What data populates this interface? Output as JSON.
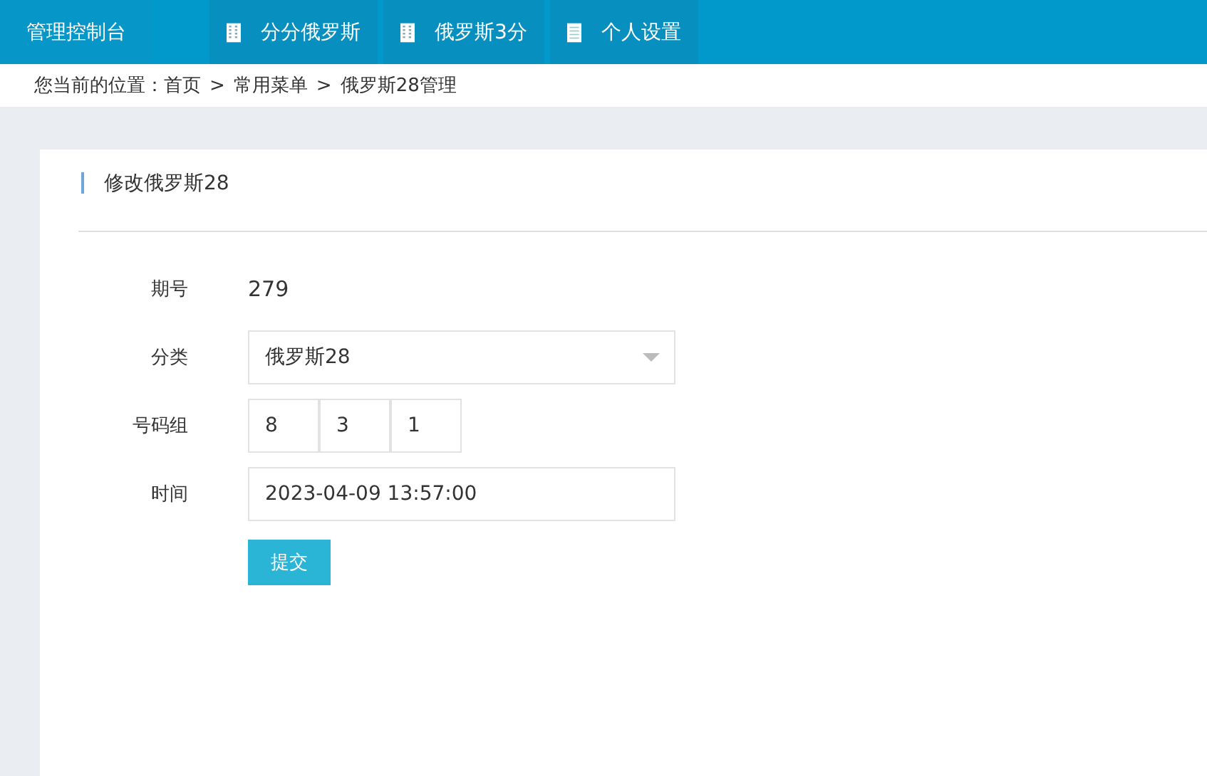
{
  "top_nav": {
    "brand": "管理控制台",
    "items": [
      {
        "label": "分分俄罗斯"
      },
      {
        "label": "俄罗斯3分"
      },
      {
        "label": "个人设置",
        "kind": "doc"
      }
    ]
  },
  "breadcrumb": {
    "prefix": "您当前的位置：",
    "separator": ">",
    "items": [
      "首页",
      "常用菜单",
      "俄罗斯28管理"
    ]
  },
  "card": {
    "title": "修改俄罗斯28",
    "fields": [
      {
        "kind": "text",
        "label": "期号",
        "value": "279"
      },
      {
        "kind": "select",
        "label": "分类",
        "value": "俄罗斯28"
      },
      {
        "kind": "group",
        "label": "号码组",
        "values": [
          "8",
          "3",
          "1"
        ]
      },
      {
        "kind": "input",
        "label": "时间",
        "value": "2023-04-09 13:57:00"
      }
    ],
    "submit": "提交"
  }
}
